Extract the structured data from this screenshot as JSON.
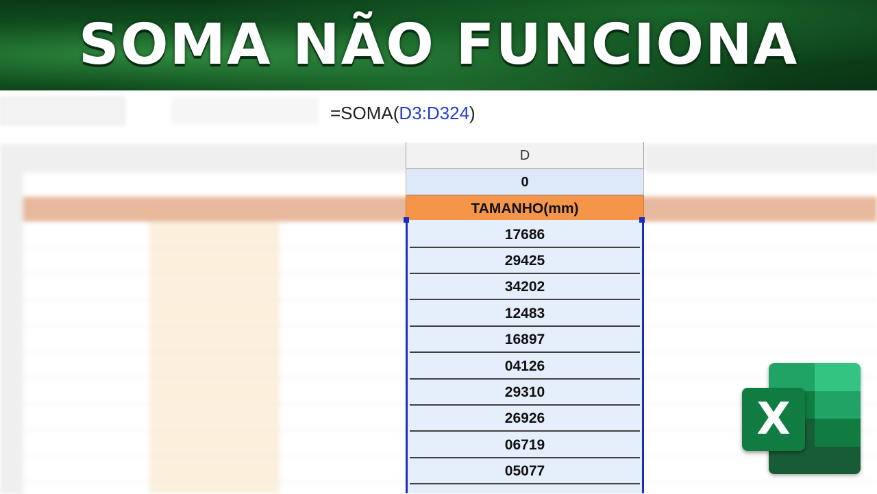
{
  "banner": {
    "title": "SOMA NÃO FUNCIONA"
  },
  "formula_bar": {
    "prefix": "=SOMA(",
    "range": "D3:D324",
    "suffix": ")"
  },
  "column_d": {
    "header": "D",
    "total": "0",
    "field_name": "TAMANHO(mm)",
    "values": [
      "17686",
      "29425",
      "34202",
      "12483",
      "16897",
      "04126",
      "29310",
      "26926",
      "06719",
      "05077"
    ]
  },
  "colors": {
    "banner_green": "#0f4a1d",
    "header_orange": "#f5954a",
    "selection_blue": "#1a2cc4",
    "selected_fill": "#e5eefb",
    "excel_green": "#107c41"
  },
  "icons": {
    "app_logo": "excel-logo-icon"
  }
}
